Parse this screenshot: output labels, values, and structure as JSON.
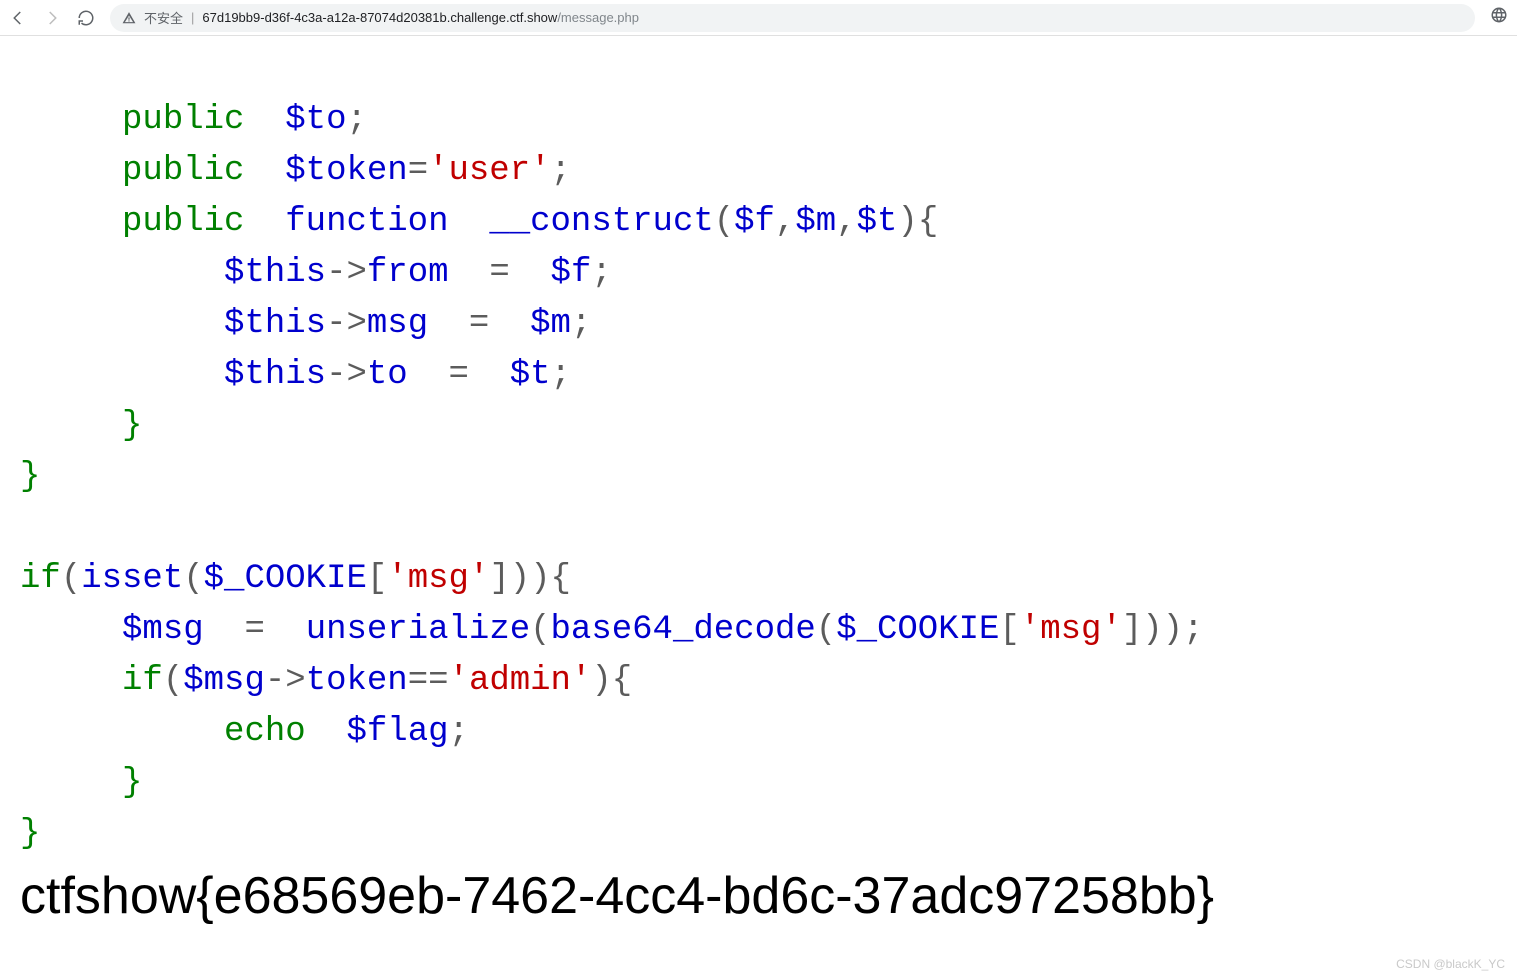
{
  "toolbar": {
    "insecure_label": "不安全",
    "url_host": "67d19bb9-d36f-4c3a-a12a-87074d20381b.challenge.ctf.show",
    "url_path": "/message.php"
  },
  "code": {
    "l1": {
      "kw": "public",
      "var": "$to",
      "semi": ";"
    },
    "l2": {
      "kw": "public",
      "var": "$token",
      "eq": "=",
      "q1": "'",
      "str": "user",
      "q2": "'",
      "semi": ";"
    },
    "l3": {
      "kw": "public",
      "kw2": "function",
      "name": "__construct",
      "args_open": "(",
      "a1": "$f",
      "c1": ",",
      "a2": "$m",
      "c2": ",",
      "a3": "$t",
      "args_close": ")",
      "brace": "{"
    },
    "l4": {
      "lhs": "$this",
      "arrow": "->",
      "prop": "from",
      "eq": "=",
      "rhs": "$f",
      "semi": ";"
    },
    "l5": {
      "lhs": "$this",
      "arrow": "->",
      "prop": "msg",
      "eq": "=",
      "rhs": "$m",
      "semi": ";"
    },
    "l6": {
      "lhs": "$this",
      "arrow": "->",
      "prop": "to",
      "eq": "=",
      "rhs": "$t",
      "semi": ";"
    },
    "l7": {
      "brace": "}"
    },
    "l8": {
      "brace": "}"
    },
    "l9": {
      "kw": "if",
      "p1": "(",
      "fn": "isset",
      "p2": "(",
      "arr": "$_COOKIE",
      "b1": "[",
      "q1": "'",
      "key": "msg",
      "q2": "'",
      "b2": "]",
      "p3": ")",
      "p4": ")",
      "brace": "{"
    },
    "l10": {
      "lhs": "$msg",
      "eq": "=",
      "fn1": "unserialize",
      "p1": "(",
      "fn2": "base64_decode",
      "p2": "(",
      "arr": "$_COOKIE",
      "b1": "[",
      "q1": "'",
      "key": "msg",
      "q2": "'",
      "b2": "]",
      "p3": ")",
      "p4": ")",
      "semi": ";"
    },
    "l11": {
      "kw": "if",
      "p1": "(",
      "lhs": "$msg",
      "arrow": "->",
      "prop": "token",
      "eqeq": "==",
      "q1": "'",
      "str": "admin",
      "q2": "'",
      "p2": ")",
      "brace": "{"
    },
    "l12": {
      "kw": "echo",
      "var": "$flag",
      "semi": ";"
    },
    "l13": {
      "brace": "}"
    },
    "l14": {
      "brace": "}"
    }
  },
  "flag": "ctfshow{e68569eb-7462-4cc4-bd6c-37adc97258bb}",
  "watermark": "CSDN @blackK_YC"
}
